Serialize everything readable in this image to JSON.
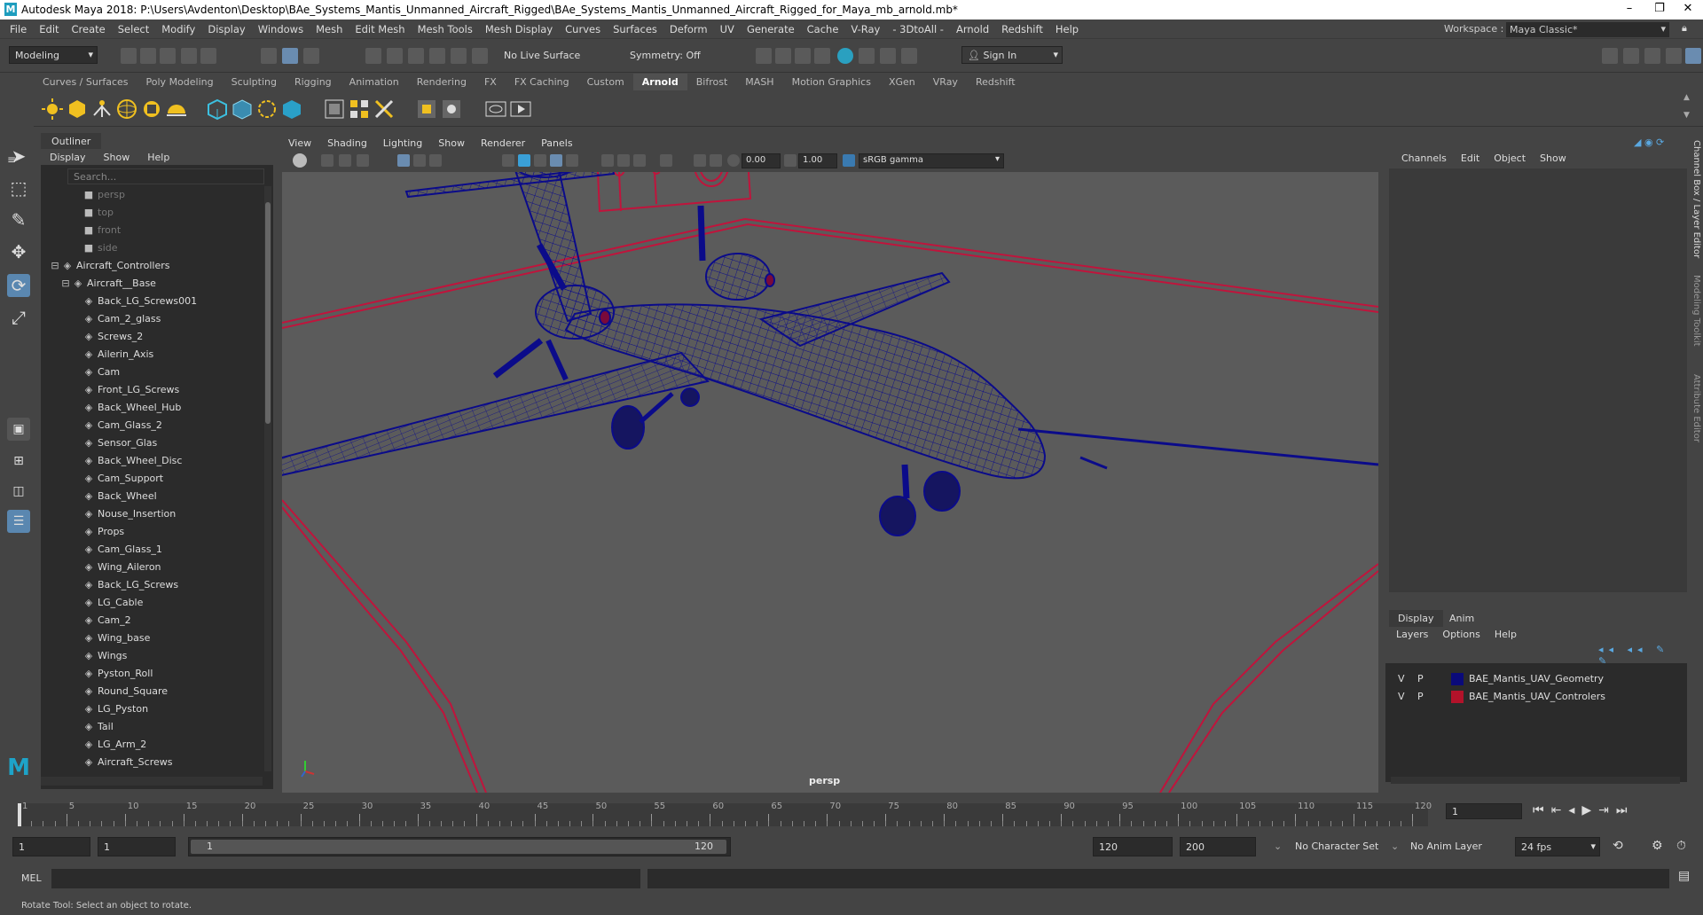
{
  "titlebar": {
    "title": "Autodesk Maya 2018: P:\\Users\\Avdenton\\Desktop\\BAe_Systems_Mantis_Unmanned_Aircraft_Rigged\\BAe_Systems_Mantis_Unmanned_Aircraft_Rigged_for_Maya_mb_arnold.mb*",
    "minimize": "–",
    "maximize": "❐",
    "close": "✕"
  },
  "menubar": {
    "items": [
      "File",
      "Edit",
      "Create",
      "Select",
      "Modify",
      "Display",
      "Windows",
      "Mesh",
      "Edit Mesh",
      "Mesh Tools",
      "Mesh Display",
      "Curves",
      "Surfaces",
      "Deform",
      "UV",
      "Generate",
      "Cache",
      "V-Ray",
      "- 3DtoAll -",
      "Arnold",
      "Redshift",
      "Help"
    ],
    "workspace_label": "Workspace :",
    "workspace_value": "Maya Classic*"
  },
  "statusline": {
    "menuset": "Modeling",
    "live_surface": "No Live Surface",
    "symmetry": "Symmetry: Off",
    "sign_in": "Sign In"
  },
  "shelf": {
    "tabs": [
      "Curves / Surfaces",
      "Poly Modeling",
      "Sculpting",
      "Rigging",
      "Animation",
      "Rendering",
      "FX",
      "FX Caching",
      "Custom",
      "Arnold",
      "Bifrost",
      "MASH",
      "Motion Graphics",
      "XGen",
      "VRay",
      "Redshift"
    ],
    "active_tab": "Arnold"
  },
  "outliner": {
    "tab": "Outliner",
    "menu": [
      "Display",
      "Show",
      "Help"
    ],
    "search_placeholder": "Search...",
    "cameras": [
      "persp",
      "top",
      "front",
      "side"
    ],
    "root": "Aircraft_Controllers",
    "base": "Aircraft__Base",
    "items": [
      "Back_LG_Screws001",
      "Cam_2_glass",
      "Screws_2",
      "Ailerin_Axis",
      "Cam",
      "Front_LG_Screws",
      "Back_Wheel_Hub",
      "Cam_Glass_2",
      "Sensor_Glas",
      "Back_Wheel_Disc",
      "Cam_Support",
      "Back_Wheel",
      "Nouse_Insertion",
      "Props",
      "Cam_Glass_1",
      "Wing_Aileron",
      "Back_LG_Screws",
      "LG_Cable",
      "Cam_2",
      "Wing_base",
      "Wings",
      "Pyston_Roll",
      "Round_Square",
      "LG_Pyston",
      "Tail",
      "LG_Arm_2",
      "Aircraft_Screws"
    ]
  },
  "viewport": {
    "menu": [
      "View",
      "Shading",
      "Lighting",
      "Show",
      "Renderer",
      "Panels"
    ],
    "exposure": "0.00",
    "gamma": "1.00",
    "colorspace": "sRGB gamma",
    "camera_label": "persp"
  },
  "channelbox": {
    "menu": [
      "Channels",
      "Edit",
      "Object",
      "Show"
    ],
    "side_tabs": [
      "Channel Box / Layer Editor",
      "Modeling Toolkit",
      "Attribute Editor"
    ]
  },
  "layers": {
    "tabs": [
      "Display",
      "Anim"
    ],
    "menu": [
      "Layers",
      "Options",
      "Help"
    ],
    "rows": [
      {
        "v": "V",
        "p": "P",
        "name": "BAE_Mantis_UAV_Geometry",
        "color": "#0a0a7a"
      },
      {
        "v": "V",
        "p": "P",
        "name": "BAE_Mantis_UAV_Controlers",
        "color": "#b3122a"
      }
    ]
  },
  "timeline": {
    "ticks": [
      "1",
      "5",
      "10",
      "15",
      "20",
      "25",
      "30",
      "35",
      "40",
      "45",
      "50",
      "55",
      "60",
      "65",
      "70",
      "75",
      "80",
      "85",
      "90",
      "95",
      "100",
      "105",
      "110",
      "115",
      "120"
    ],
    "current_frame": "1"
  },
  "range": {
    "start": "1",
    "playback_start": "1",
    "slider_start": "1",
    "slider_end": "120",
    "playback_end": "120",
    "end": "200",
    "character_set": "No Character Set",
    "anim_layer": "No Anim Layer",
    "fps": "24 fps"
  },
  "mel": {
    "label": "MEL"
  },
  "helpline": {
    "text": "Rotate Tool: Select an object to rotate."
  },
  "colors": {
    "wire": "#0b0b8a",
    "controller": "#c0143c",
    "viewport_bg": "#5b5b5b"
  }
}
